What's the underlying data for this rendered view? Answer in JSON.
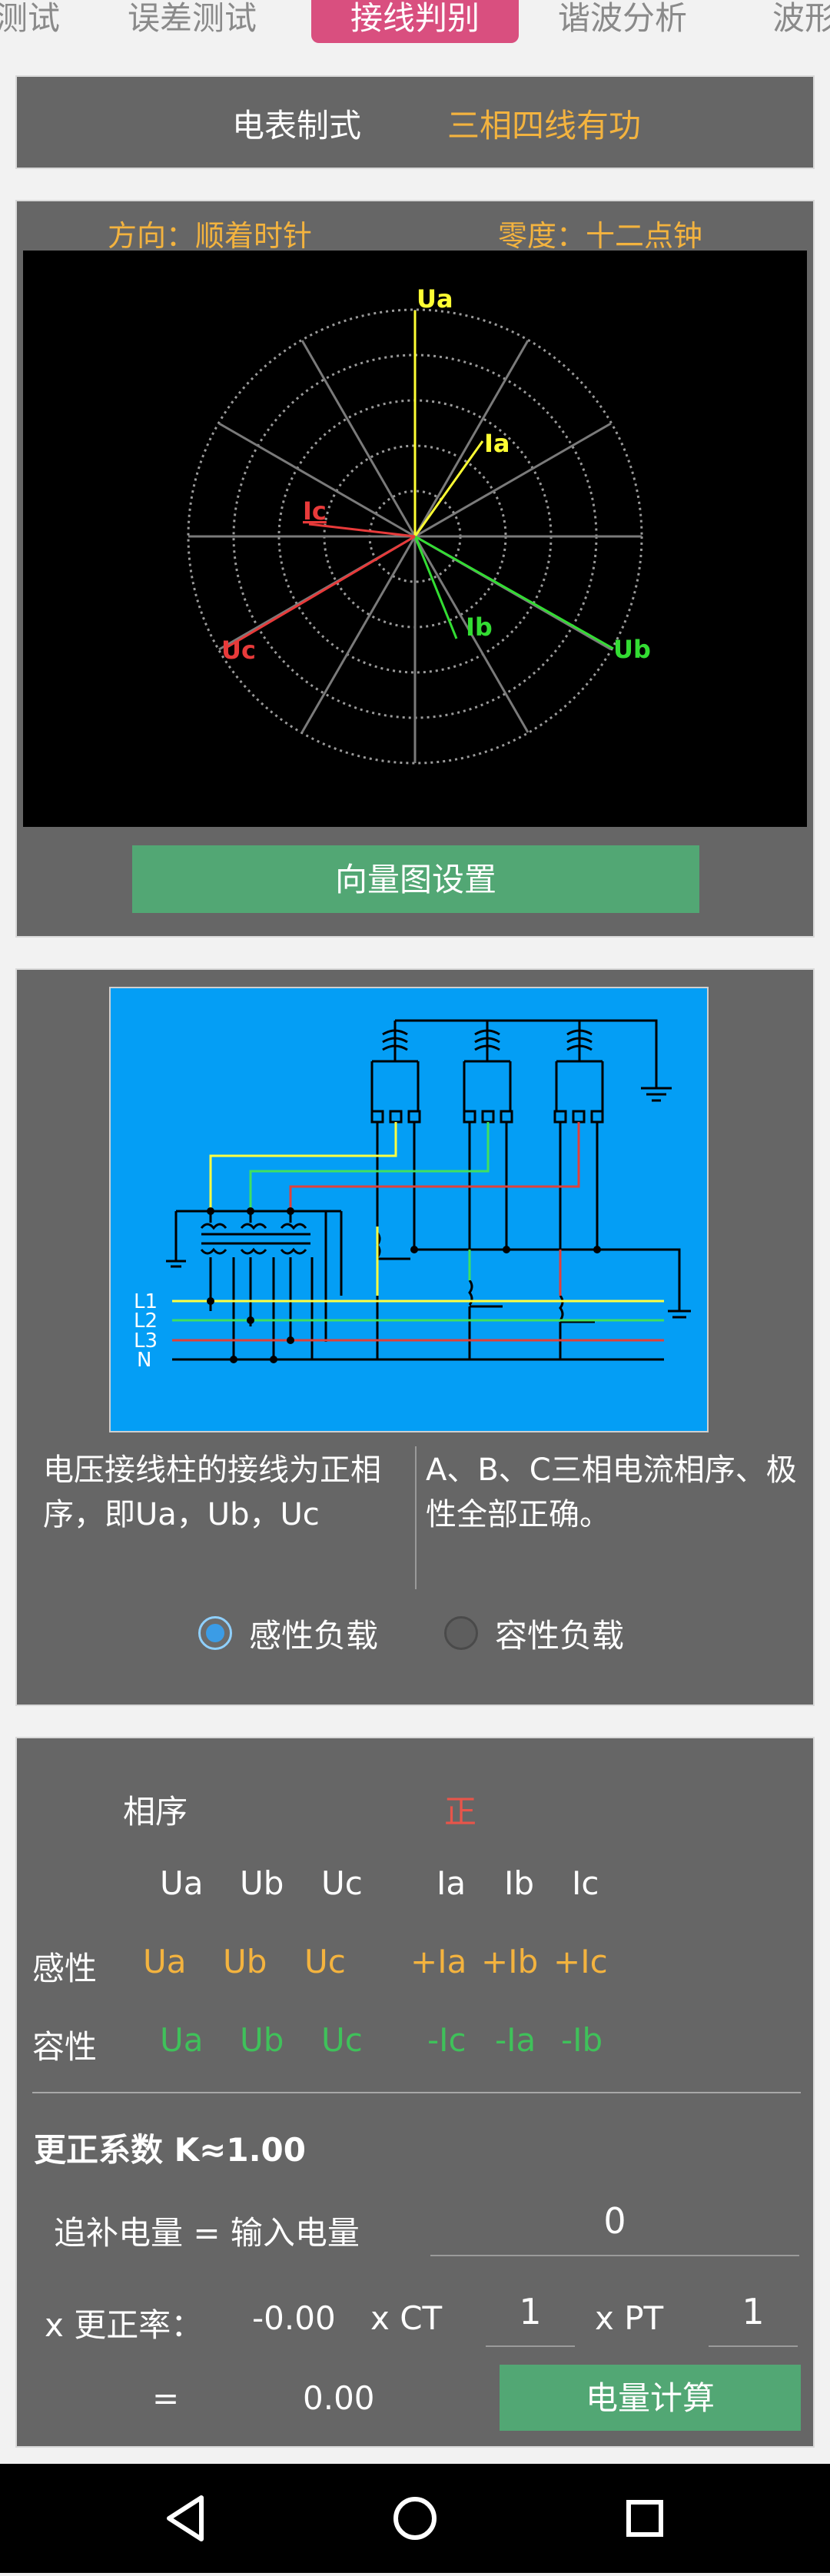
{
  "tabs": [
    "测试",
    "误差测试",
    "接线判别",
    "谐波分析",
    "波形"
  ],
  "meter": {
    "label": "电表制式",
    "value": "三相四线有功"
  },
  "vector": {
    "direction": "方向：顺着时针",
    "zero": "零度：十二点钟",
    "labels": {
      "ua": "Ua",
      "ia": "Ia",
      "ic": "Ic",
      "ib": "Ib",
      "ub": "Ub",
      "uc": "Uc"
    },
    "settings_button": "向量图设置"
  },
  "wiring": {
    "line_labels": [
      "L1",
      "L2",
      "L3",
      "N"
    ],
    "voltage_desc": "电压接线柱的接线为正相序，即Ua，Ub，Uc",
    "current_desc": "A、B、C三相电流相序、极性全部正确。",
    "load_options": [
      {
        "label": "感性负载",
        "checked": true
      },
      {
        "label": "容性负载",
        "checked": false
      }
    ]
  },
  "result": {
    "phase_seq_label": "相序",
    "phase_seq_value": "正",
    "header": [
      "Ua",
      "Ub",
      "Uc",
      "Ia",
      "Ib",
      "Ic"
    ],
    "inductive_label": "感性",
    "inductive": [
      "Ua",
      "Ub",
      "Uc",
      "+Ia",
      "+Ib",
      "+Ic"
    ],
    "capacitive_label": "容性",
    "capacitive": [
      "Ua",
      "Ub",
      "Uc",
      "-Ic",
      "-Ia",
      "-Ib"
    ],
    "correction_label": "更正系数  K≈1.00",
    "supplement_label": "追补电量 = 输入电量",
    "input_energy": "0",
    "rate_label": "x 更正率：",
    "rate_value": "-0.00",
    "ct_label": "x CT",
    "ct_value": "1",
    "pt_label": "x PT",
    "pt_value": "1",
    "equals": "=",
    "total": "0.00",
    "calc_button": "电量计算"
  },
  "colors": {
    "accent": "#d94f7f",
    "orange": "#f3b33f",
    "green": "#3fc15a",
    "red": "#e8554a",
    "button": "#52a774"
  },
  "nav_icons": [
    "back-icon",
    "home-icon",
    "recents-icon"
  ]
}
